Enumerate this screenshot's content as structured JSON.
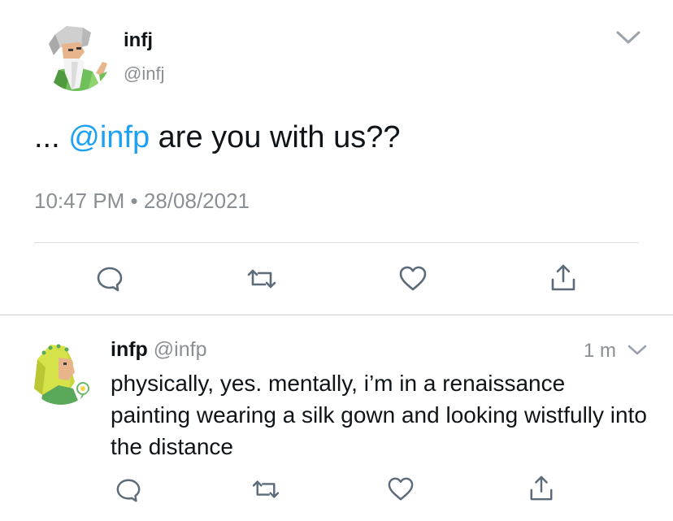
{
  "main_tweet": {
    "author_name": "infj",
    "author_handle": "@infj",
    "text_prefix": "...",
    "mention": "@infp",
    "text_suffix": "are you with us??",
    "time": "10:47 PM",
    "separator": "•",
    "date": "28/08/2021"
  },
  "reply": {
    "author_name": "infp",
    "author_handle": "@infp",
    "time_ago": "1 m",
    "text": "physically, yes. mentally, i’m in a renaissance painting wearing a silk gown and looking wistfully into the distance"
  },
  "icons": {
    "more": "chevron-down-icon",
    "reply": "speech-bubble-icon",
    "retweet": "retweet-icon",
    "like": "heart-icon",
    "share": "share-icon"
  },
  "colors": {
    "mention": "#1da1f2",
    "icon": "#5b6b7a",
    "muted_text": "#8a8f94",
    "divider": "#d9dde0"
  }
}
